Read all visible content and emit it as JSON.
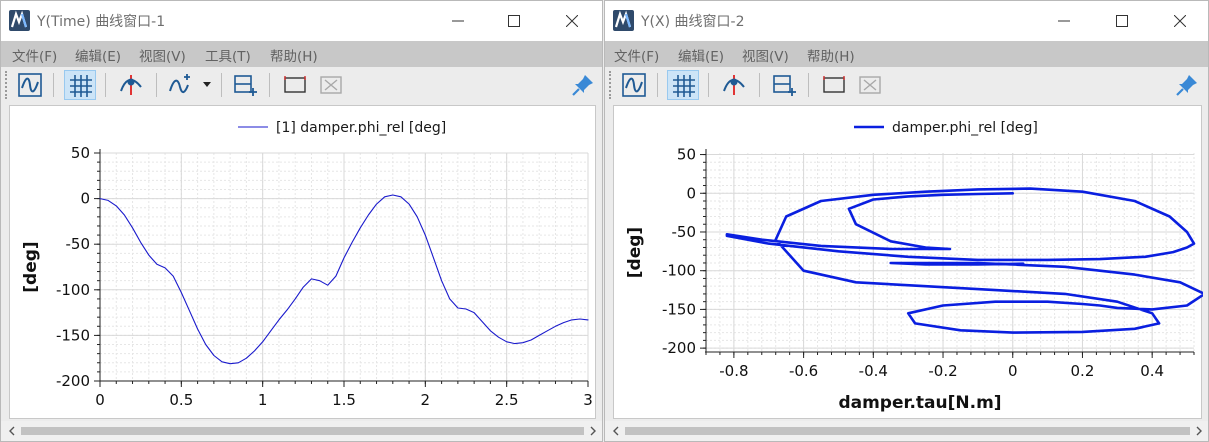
{
  "theme": {
    "accent": "#0078d7",
    "curve1": "#1a1acc",
    "curve2": "#0a1fe0",
    "pin": "#3a89d6",
    "icon_blue": "#1f5a94"
  },
  "windows": [
    {
      "id": "win1",
      "title": "Y(Time) 曲线窗口-1",
      "menu": [
        "文件(F)",
        "编辑(E)",
        "视图(V)",
        "工具(T)",
        "帮助(H)"
      ],
      "toolbar": [
        "curve-icon",
        "grid-icon",
        "marker-icon",
        "add-curve-icon",
        "dropdown-arrow-icon",
        "add-subplot-icon",
        "rectangle-icon",
        "delete-box-icon",
        "pin-icon"
      ],
      "chart_data": {
        "type": "line",
        "legend": "[1] damper.phi_rel [deg]",
        "xlabel": "",
        "ylabel": "[deg]",
        "xlim": [
          0,
          3
        ],
        "ylim": [
          -200,
          50
        ],
        "xticks": [
          0,
          0.5,
          1,
          1.5,
          2,
          2.5,
          3
        ],
        "xtick_labels": [
          "0",
          "0.5",
          "1",
          "1.5",
          "2",
          "2.5",
          "3"
        ],
        "yticks": [
          50,
          0,
          -50,
          -100,
          -150,
          -200
        ],
        "ytick_labels": [
          "50",
          "0",
          "-50",
          "-100",
          "-150",
          "-200"
        ],
        "grid": true,
        "series": [
          {
            "name": "[1] damper.phi_rel [deg]",
            "x": [
              0,
              0.05,
              0.1,
              0.15,
              0.2,
              0.25,
              0.3,
              0.35,
              0.4,
              0.45,
              0.5,
              0.55,
              0.6,
              0.65,
              0.7,
              0.75,
              0.8,
              0.85,
              0.9,
              0.95,
              1.0,
              1.05,
              1.1,
              1.15,
              1.2,
              1.25,
              1.3,
              1.35,
              1.4,
              1.45,
              1.5,
              1.55,
              1.6,
              1.65,
              1.7,
              1.75,
              1.8,
              1.85,
              1.9,
              1.95,
              2.0,
              2.05,
              2.1,
              2.15,
              2.2,
              2.25,
              2.3,
              2.35,
              2.4,
              2.45,
              2.5,
              2.55,
              2.6,
              2.65,
              2.7,
              2.75,
              2.8,
              2.85,
              2.9,
              2.95,
              3.0
            ],
            "y": [
              0,
              -2,
              -8,
              -18,
              -32,
              -48,
              -62,
              -72,
              -76,
              -85,
              -103,
              -123,
              -143,
              -160,
              -172,
              -179,
              -181,
              -180,
              -175,
              -167,
              -157,
              -145,
              -133,
              -122,
              -110,
              -97,
              -88,
              -90,
              -95,
              -85,
              -65,
              -48,
              -32,
              -18,
              -6,
              2,
              4,
              2,
              -6,
              -20,
              -40,
              -65,
              -90,
              -110,
              -120,
              -121,
              -125,
              -135,
              -145,
              -152,
              -157,
              -159,
              -158,
              -155,
              -150,
              -145,
              -140,
              -136,
              -133,
              -132,
              -133
            ]
          }
        ]
      }
    },
    {
      "id": "win2",
      "title": "Y(X) 曲线窗口-2",
      "menu": [
        "文件(F)",
        "编辑(E)",
        "视图(V)",
        "帮助(H)"
      ],
      "toolbar": [
        "curve-icon",
        "grid-icon",
        "marker-icon",
        "add-subplot-icon",
        "rectangle-icon",
        "delete-box-icon",
        "pin-icon"
      ],
      "chart_data": {
        "type": "line",
        "legend": "damper.phi_rel [deg]",
        "xlabel": "damper.tau[N.m]",
        "ylabel": "[deg]",
        "xlim": [
          -0.88,
          0.52
        ],
        "ylim": [
          -205,
          52
        ],
        "xticks": [
          -0.8,
          -0.6,
          -0.4,
          -0.2,
          0,
          0.2,
          0.4
        ],
        "xtick_labels": [
          "-0.8",
          "-0.6",
          "-0.4",
          "-0.2",
          "0",
          "0.2",
          "0.4"
        ],
        "yticks": [
          50,
          0,
          -50,
          -100,
          -150,
          -200
        ],
        "ytick_labels": [
          "50",
          "0",
          "-50",
          "-100",
          "-150",
          "-200"
        ],
        "grid": true,
        "series": [
          {
            "name": "damper.phi_rel [deg]",
            "x": [
              0.0,
              -0.1,
              -0.2,
              -0.3,
              -0.4,
              -0.47,
              -0.45,
              -0.35,
              -0.25,
              -0.18,
              -0.35,
              -0.55,
              -0.72,
              -0.82,
              -0.82,
              -0.7,
              -0.5,
              -0.3,
              -0.1,
              0.1,
              0.25,
              0.38,
              0.46,
              0.5,
              0.52,
              0.5,
              0.45,
              0.35,
              0.2,
              0.05,
              -0.1,
              -0.25,
              -0.4,
              -0.55,
              -0.65,
              -0.68,
              -0.6,
              -0.45,
              -0.25,
              -0.05,
              0.15,
              0.3,
              0.4,
              0.42,
              0.35,
              0.2,
              0.0,
              -0.15,
              -0.28,
              -0.3,
              -0.2,
              -0.05,
              0.1,
              0.2,
              0.25,
              0.3,
              0.4,
              0.5,
              0.55,
              0.48,
              0.35,
              0.15,
              -0.1,
              -0.3,
              -0.35,
              -0.25,
              -0.1,
              0.03
            ],
            "y": [
              0,
              -1,
              -2,
              -4,
              -8,
              -20,
              -40,
              -62,
              -70,
              -72,
              -72,
              -68,
              -60,
              -53,
              -55,
              -65,
              -75,
              -82,
              -86,
              -86,
              -85,
              -82,
              -76,
              -70,
              -65,
              -50,
              -30,
              -10,
              2,
              6,
              5,
              2,
              -2,
              -10,
              -30,
              -60,
              -100,
              -115,
              -120,
              -125,
              -130,
              -140,
              -155,
              -168,
              -175,
              -179,
              -180,
              -177,
              -168,
              -155,
              -145,
              -140,
              -140,
              -143,
              -145,
              -148,
              -150,
              -145,
              -130,
              -115,
              -105,
              -95,
              -90,
              -90,
              -90,
              -92,
              -92,
              -91
            ]
          }
        ]
      }
    }
  ]
}
